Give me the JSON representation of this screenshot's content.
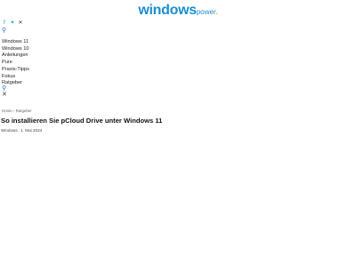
{
  "header": {
    "logo_main": "windows",
    "logo_sub": "power",
    "logo_dot": "."
  },
  "social": {
    "facebook_icon": "f",
    "twitter_icon": "✦",
    "x_icon": "✕"
  },
  "search_icon_glyph": "⚲",
  "close_icon_glyph": "✕",
  "nav": {
    "items": [
      "Windows 11",
      "Windows 10",
      "Anleitungen",
      "Pure",
      "Praxis-Tipps",
      "Fokus",
      "Ratgeber"
    ]
  },
  "breadcrumb": "Home › Ratgeber",
  "article": {
    "title": "So installieren Sie pCloud Drive unter Windows 11",
    "author": "Windows",
    "date": "1. Mai 2024"
  },
  "colors": {
    "brand": "#1b8fd0",
    "accent_dot": "#f0a030"
  }
}
